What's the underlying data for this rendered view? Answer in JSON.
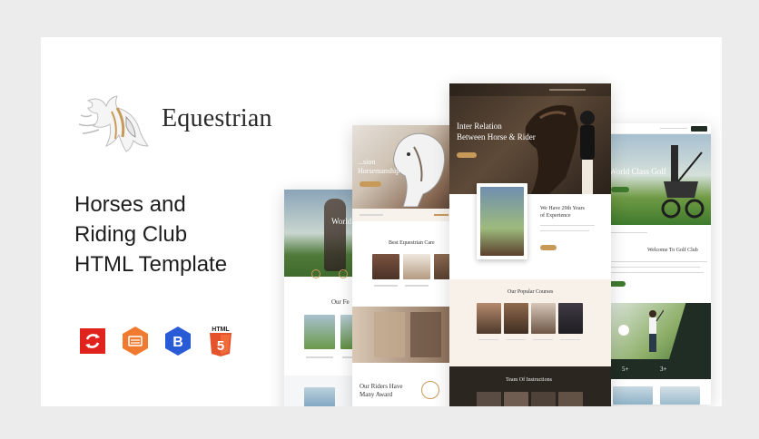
{
  "brand": {
    "name": "Equestrian"
  },
  "headline": {
    "line1": "Horses and",
    "line2": "Riding Club",
    "line3": "HTML Template"
  },
  "badges": [
    {
      "icon": "responsive-icon",
      "color": "#e0231c"
    },
    {
      "icon": "sass-badge-icon",
      "color": "#f07a2f"
    },
    {
      "icon": "bootstrap-icon",
      "color": "#2a5bd7"
    },
    {
      "icon": "html5-icon",
      "color": "#e5532d",
      "label": "HTML",
      "number": "5"
    }
  ],
  "mockups": {
    "s1": {
      "hero": "World",
      "section": "Our Fe"
    },
    "s2": {
      "hero_line1": "...sion",
      "hero_line2": "Horsemanship",
      "section": "Best Equestrian Care",
      "award_line1": "Our Riders Have",
      "award_line2": "Many Award"
    },
    "s3": {
      "hero_line1": "Inter Relation",
      "hero_line2": "Between Horse & Rider",
      "years_line1": "We Have 29th Years",
      "years_line2": "of Experience",
      "courses": "Our Popular Courses",
      "team": "Team Of Instructions"
    },
    "s4": {
      "hero": "World Class Golf",
      "welcome": "Welcome To Golf Club",
      "stat1": "5+",
      "stat2": "3+"
    }
  },
  "colors": {
    "accent": "#c89a5a",
    "dark": "#2b2620",
    "green": "#3e7a2d"
  }
}
